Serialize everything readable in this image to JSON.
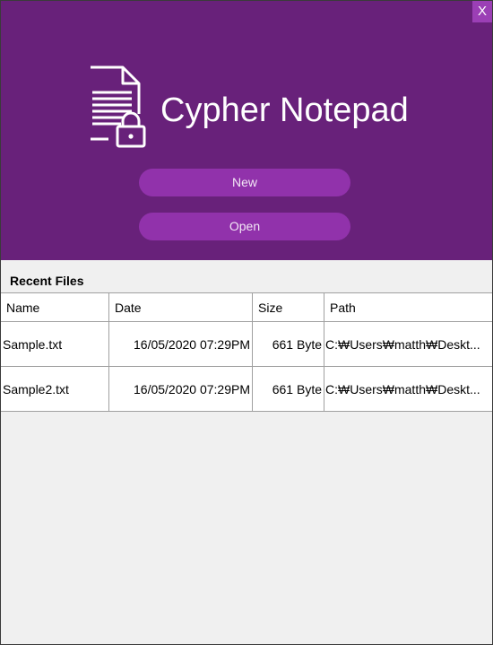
{
  "window": {
    "close_label": "X"
  },
  "header": {
    "title": "Cypher Notepad",
    "bg_color": "#68217a",
    "button_color": "#9132ab",
    "logo_icon": "document-lock-icon"
  },
  "actions": {
    "new_label": "New",
    "open_label": "Open"
  },
  "recent": {
    "title": "Recent Files",
    "columns": [
      "Name",
      "Date",
      "Size",
      "Path"
    ],
    "rows": [
      [
        "Sample.txt",
        "16/05/2020 07:29PM",
        "661 Byte",
        "C:₩Users₩matth₩Deskt..."
      ],
      [
        "Sample2.txt",
        "16/05/2020 07:29PM",
        "661 Byte",
        "C:₩Users₩matth₩Deskt..."
      ]
    ]
  }
}
